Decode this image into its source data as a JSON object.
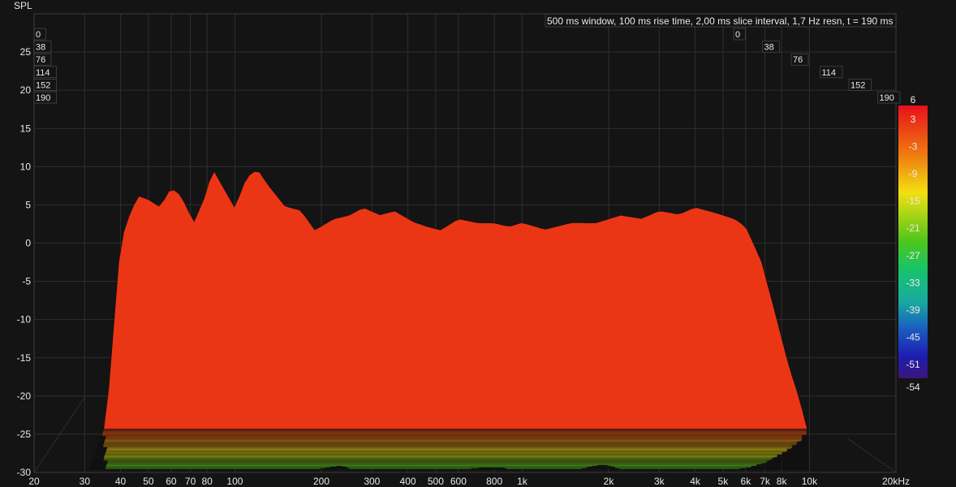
{
  "chart_data": {
    "type": "waterfall",
    "title": "500 ms window, 100 ms rise time, 2,00 ms slice interval, 1,7 Hz resn, t = 190 ms",
    "ylabel": "SPL",
    "xlim": [
      20,
      20000
    ],
    "ylim": [
      -30,
      30
    ],
    "x_scale": "log",
    "x_ticks": [
      {
        "value": 20,
        "label": "20"
      },
      {
        "value": 30,
        "label": "30"
      },
      {
        "value": 40,
        "label": "40"
      },
      {
        "value": 50,
        "label": "50"
      },
      {
        "value": 60,
        "label": "60"
      },
      {
        "value": 70,
        "label": "70"
      },
      {
        "value": 80,
        "label": "80"
      },
      {
        "value": 100,
        "label": "100"
      },
      {
        "value": 200,
        "label": "200"
      },
      {
        "value": 300,
        "label": "300"
      },
      {
        "value": 400,
        "label": "400"
      },
      {
        "value": 500,
        "label": "500"
      },
      {
        "value": 600,
        "label": "600"
      },
      {
        "value": 800,
        "label": "800"
      },
      {
        "value": 1000,
        "label": "1k"
      },
      {
        "value": 2000,
        "label": "2k"
      },
      {
        "value": 3000,
        "label": "3k"
      },
      {
        "value": 4000,
        "label": "4k"
      },
      {
        "value": 5000,
        "label": "5k"
      },
      {
        "value": 6000,
        "label": "6k"
      },
      {
        "value": 7000,
        "label": "7k"
      },
      {
        "value": 8000,
        "label": "8k"
      },
      {
        "value": 10000,
        "label": "10k"
      },
      {
        "value": 20000,
        "label": "20kHz"
      }
    ],
    "y_ticks": [
      25,
      20,
      15,
      10,
      5,
      0,
      -5,
      -10,
      -15,
      -20,
      -25,
      -30
    ],
    "time_ticks_ms": [
      "0",
      "38",
      "76",
      "114",
      "152",
      "190"
    ],
    "colorbar_ticks": [
      "6",
      "3",
      "-3",
      "-9",
      "-15",
      "-21",
      "-27",
      "-33",
      "-39",
      "-45",
      "-51",
      "-54"
    ],
    "colorbar_range": [
      -54,
      6
    ],
    "slice_interval_ms": 2,
    "time_span_ms": [
      0,
      190
    ],
    "front_response_db": [
      [
        35,
        -27
      ],
      [
        38,
        -10
      ],
      [
        40,
        0.5
      ],
      [
        43,
        4
      ],
      [
        46,
        6.5
      ],
      [
        50,
        6
      ],
      [
        55,
        5
      ],
      [
        60,
        7.5
      ],
      [
        65,
        6.5
      ],
      [
        72,
        3
      ],
      [
        78,
        6
      ],
      [
        84,
        10
      ],
      [
        90,
        8
      ],
      [
        100,
        5
      ],
      [
        110,
        9
      ],
      [
        120,
        10
      ],
      [
        130,
        8
      ],
      [
        150,
        5
      ],
      [
        170,
        4.5
      ],
      [
        190,
        2
      ],
      [
        220,
        3.5
      ],
      [
        250,
        4
      ],
      [
        280,
        5
      ],
      [
        320,
        4
      ],
      [
        360,
        4.5
      ],
      [
        420,
        3
      ],
      [
        460,
        2.5
      ],
      [
        520,
        2
      ],
      [
        600,
        3.5
      ],
      [
        700,
        3
      ],
      [
        800,
        3
      ],
      [
        900,
        2.5
      ],
      [
        1000,
        3
      ],
      [
        1200,
        2
      ],
      [
        1500,
        3
      ],
      [
        1800,
        3
      ],
      [
        2200,
        4
      ],
      [
        2600,
        3.5
      ],
      [
        3000,
        4.5
      ],
      [
        3500,
        4
      ],
      [
        4000,
        5
      ],
      [
        4500,
        4.5
      ],
      [
        5000,
        4
      ],
      [
        5500,
        3.5
      ],
      [
        6000,
        2.5
      ],
      [
        6800,
        -2
      ],
      [
        7500,
        -8
      ],
      [
        8500,
        -16
      ],
      [
        9200,
        -20
      ],
      [
        9800,
        -24
      ]
    ],
    "grid": true
  }
}
